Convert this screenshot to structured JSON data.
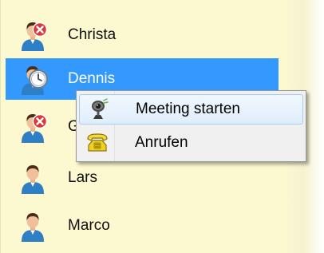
{
  "contacts": [
    {
      "name": "Christa",
      "status": "offline",
      "avatar_icon": "person-blocked-icon"
    },
    {
      "name": "Dennis",
      "status": "in-meeting",
      "avatar_icon": "person-clock-icon"
    },
    {
      "name": "G",
      "status": "offline",
      "avatar_icon": "person-blocked-icon"
    },
    {
      "name": "Lars",
      "status": "online",
      "avatar_icon": "person-icon"
    },
    {
      "name": "Marco",
      "status": "online",
      "avatar_icon": "person-icon"
    }
  ],
  "selected_contact": "Dennis",
  "context_menu": {
    "items": [
      {
        "label": "Meeting starten",
        "icon": "webcam-icon",
        "hover": true
      },
      {
        "label": "Anrufen",
        "icon": "phone-icon",
        "hover": false
      }
    ]
  },
  "colors": {
    "list_background": "#fcf8cf",
    "selection": "#3399ff",
    "menu_background": "#f0f0f0",
    "menu_hover": "#dfeefc",
    "offline_badge": "#d83a3a",
    "avatar_shirt": "#2f7fc6",
    "phone_yellow": "#f1d11b"
  }
}
